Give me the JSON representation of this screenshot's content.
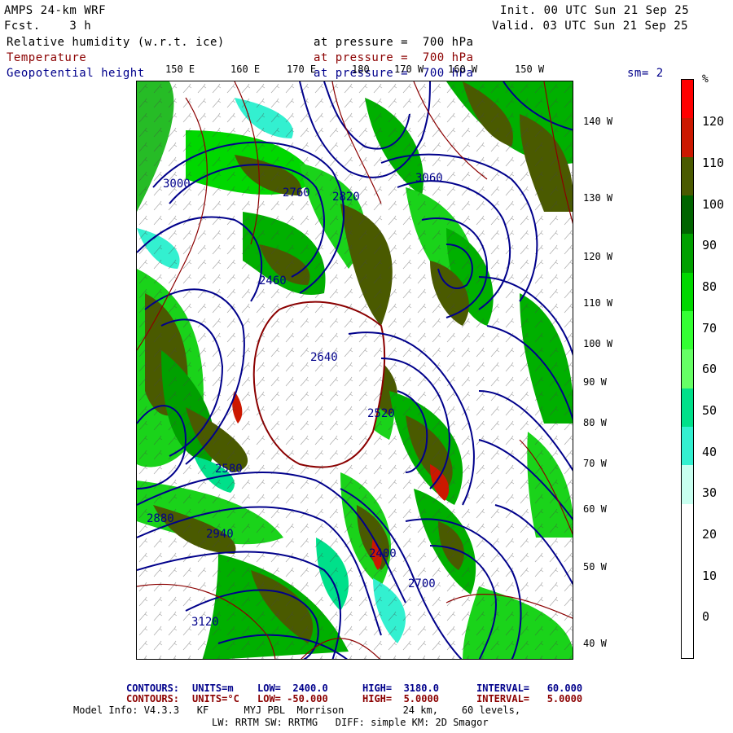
{
  "header": {
    "model": "AMPS 24-km WRF",
    "fcst": "Fcst.    3 h",
    "init": "Init. 00 UTC Sun 21 Sep 25",
    "valid": "Valid. 03 UTC Sun 21 Sep 25"
  },
  "fields": {
    "rh": "Relative humidity (w.r.t. ice)",
    "rh_pressure": "at pressure =  700 hPa",
    "temp": "Temperature",
    "temp_pressure": "at pressure =  700 hPa",
    "geo": "Geopotential height",
    "geo_pressure": "at pressure =  700 hPa",
    "sm": "sm= 2"
  },
  "lon_labels": [
    "150 E",
    "160 E",
    "170 E",
    "180",
    "170 W",
    "160 W",
    "150 W"
  ],
  "lat_labels": [
    "140 W",
    "130 W",
    "120 W",
    "110 W",
    "100 W",
    "90 W",
    "80 W",
    "70 W",
    "60 W",
    "50 W",
    "40 W"
  ],
  "height_labels": [
    "2640",
    "2520",
    "2580",
    "2760",
    "2700",
    "2880",
    "2940",
    "3000",
    "3060",
    "3120",
    "2820",
    "2460",
    "2400"
  ],
  "colorbar": {
    "unit": "%",
    "labels": [
      "120",
      "110",
      "100",
      "90",
      "80",
      "70",
      "60",
      "50",
      "40",
      "30",
      "20",
      "10",
      "0"
    ],
    "colors": [
      "#ff0000",
      "#cc1800",
      "#4a5a00",
      "#006400",
      "#00a000",
      "#00d800",
      "#33ff33",
      "#66ff66",
      "#00e08a",
      "#33f0d0",
      "#c8fff0",
      "#ffffff",
      "#ffffff",
      "#ffffff",
      "#ffffff"
    ]
  },
  "footer": {
    "c1_label": "CONTOURS:",
    "c1_units": "UNITS=m",
    "c1_low": "LOW=  2400.0",
    "c1_high": "HIGH=  3180.0",
    "c1_int": "INTERVAL=   60.000",
    "c2_label": "CONTOURS:",
    "c2_units": "UNITS=°C",
    "c2_low": "LOW= -50.000",
    "c2_high": "HIGH=  5.0000",
    "c2_int": "INTERVAL=   5.0000",
    "model_info": "Model Info: V4.3.3   KF      MYJ PBL  Morrison          24 km,    60 levels,",
    "model_info2": "LW: RRTM SW: RRTMG   DIFF: simple KM: 2D Smagor"
  }
}
